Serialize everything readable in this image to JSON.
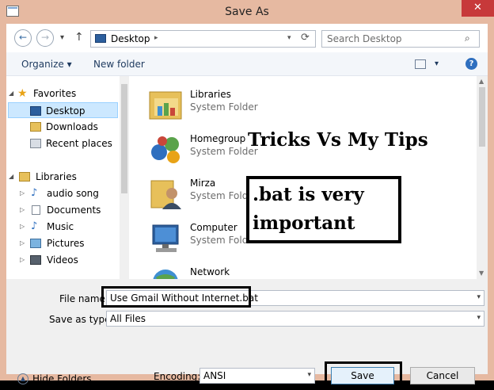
{
  "window": {
    "title": "Save As",
    "close_glyph": "✕"
  },
  "nav": {
    "back_glyph": "←",
    "forward_glyph": "→",
    "recent_glyph": "▾",
    "up_glyph": "↑",
    "address_crumb": "Desktop",
    "crumb_sep": "▸",
    "address_dd": "▾",
    "refresh_glyph": "⟳",
    "search_placeholder": "Search Desktop",
    "search_glyph": "⌕"
  },
  "toolbar": {
    "organize_label": "Organize ▾",
    "new_folder_label": "New folder",
    "view_dd": "▾",
    "help_glyph": "?"
  },
  "sidebar": {
    "items": [
      {
        "label": "Favorites",
        "arrow": "◢",
        "icon": "star-icon"
      },
      {
        "label": "Desktop",
        "arrow": "",
        "icon": "desktop-icon",
        "selected": true
      },
      {
        "label": "Downloads",
        "arrow": "",
        "icon": "downloads-icon"
      },
      {
        "label": "Recent places",
        "arrow": "",
        "icon": "recent-places-icon"
      },
      {
        "label": "Libraries",
        "arrow": "◢",
        "icon": "libraries-icon"
      },
      {
        "label": "audio song",
        "arrow": "▷",
        "icon": "music-icon"
      },
      {
        "label": "Documents",
        "arrow": "▷",
        "icon": "documents-icon"
      },
      {
        "label": "Music",
        "arrow": "▷",
        "icon": "music-icon"
      },
      {
        "label": "Pictures",
        "arrow": "▷",
        "icon": "pictures-icon"
      },
      {
        "label": "Videos",
        "arrow": "▷",
        "icon": "videos-icon"
      }
    ]
  },
  "files": [
    {
      "name": "Libraries",
      "type": "System Folder",
      "icon": "libraries-folder-icon"
    },
    {
      "name": "Homegroup",
      "type": "System Folder",
      "icon": "homegroup-icon"
    },
    {
      "name": "Mirza",
      "type": "System Folder",
      "icon": "user-folder-icon"
    },
    {
      "name": "Computer",
      "type": "System Folder",
      "icon": "computer-icon"
    },
    {
      "name": "Network",
      "type": "",
      "icon": "network-icon"
    }
  ],
  "overlay": {
    "title": "Tricks Vs My Tips",
    "box_line1": ".bat is very",
    "box_line2": "important"
  },
  "form": {
    "file_name_label": "File name",
    "file_name_value": "Use Gmail Without Internet.bat",
    "save_type_label": "Save as type:",
    "save_type_value": "All Files",
    "encoding_label": "Encoding:",
    "encoding_value": "ANSI",
    "combo_arrow": "▾"
  },
  "buttons": {
    "hide_folders": "Hide Folders",
    "hide_glyph": "▲",
    "save": "Save",
    "cancel": "Cancel"
  },
  "colors": {
    "titlebar": "#e6b9a1",
    "close": "#c7393a",
    "selection": "#cce8ff",
    "accent": "#2f6fbf"
  }
}
